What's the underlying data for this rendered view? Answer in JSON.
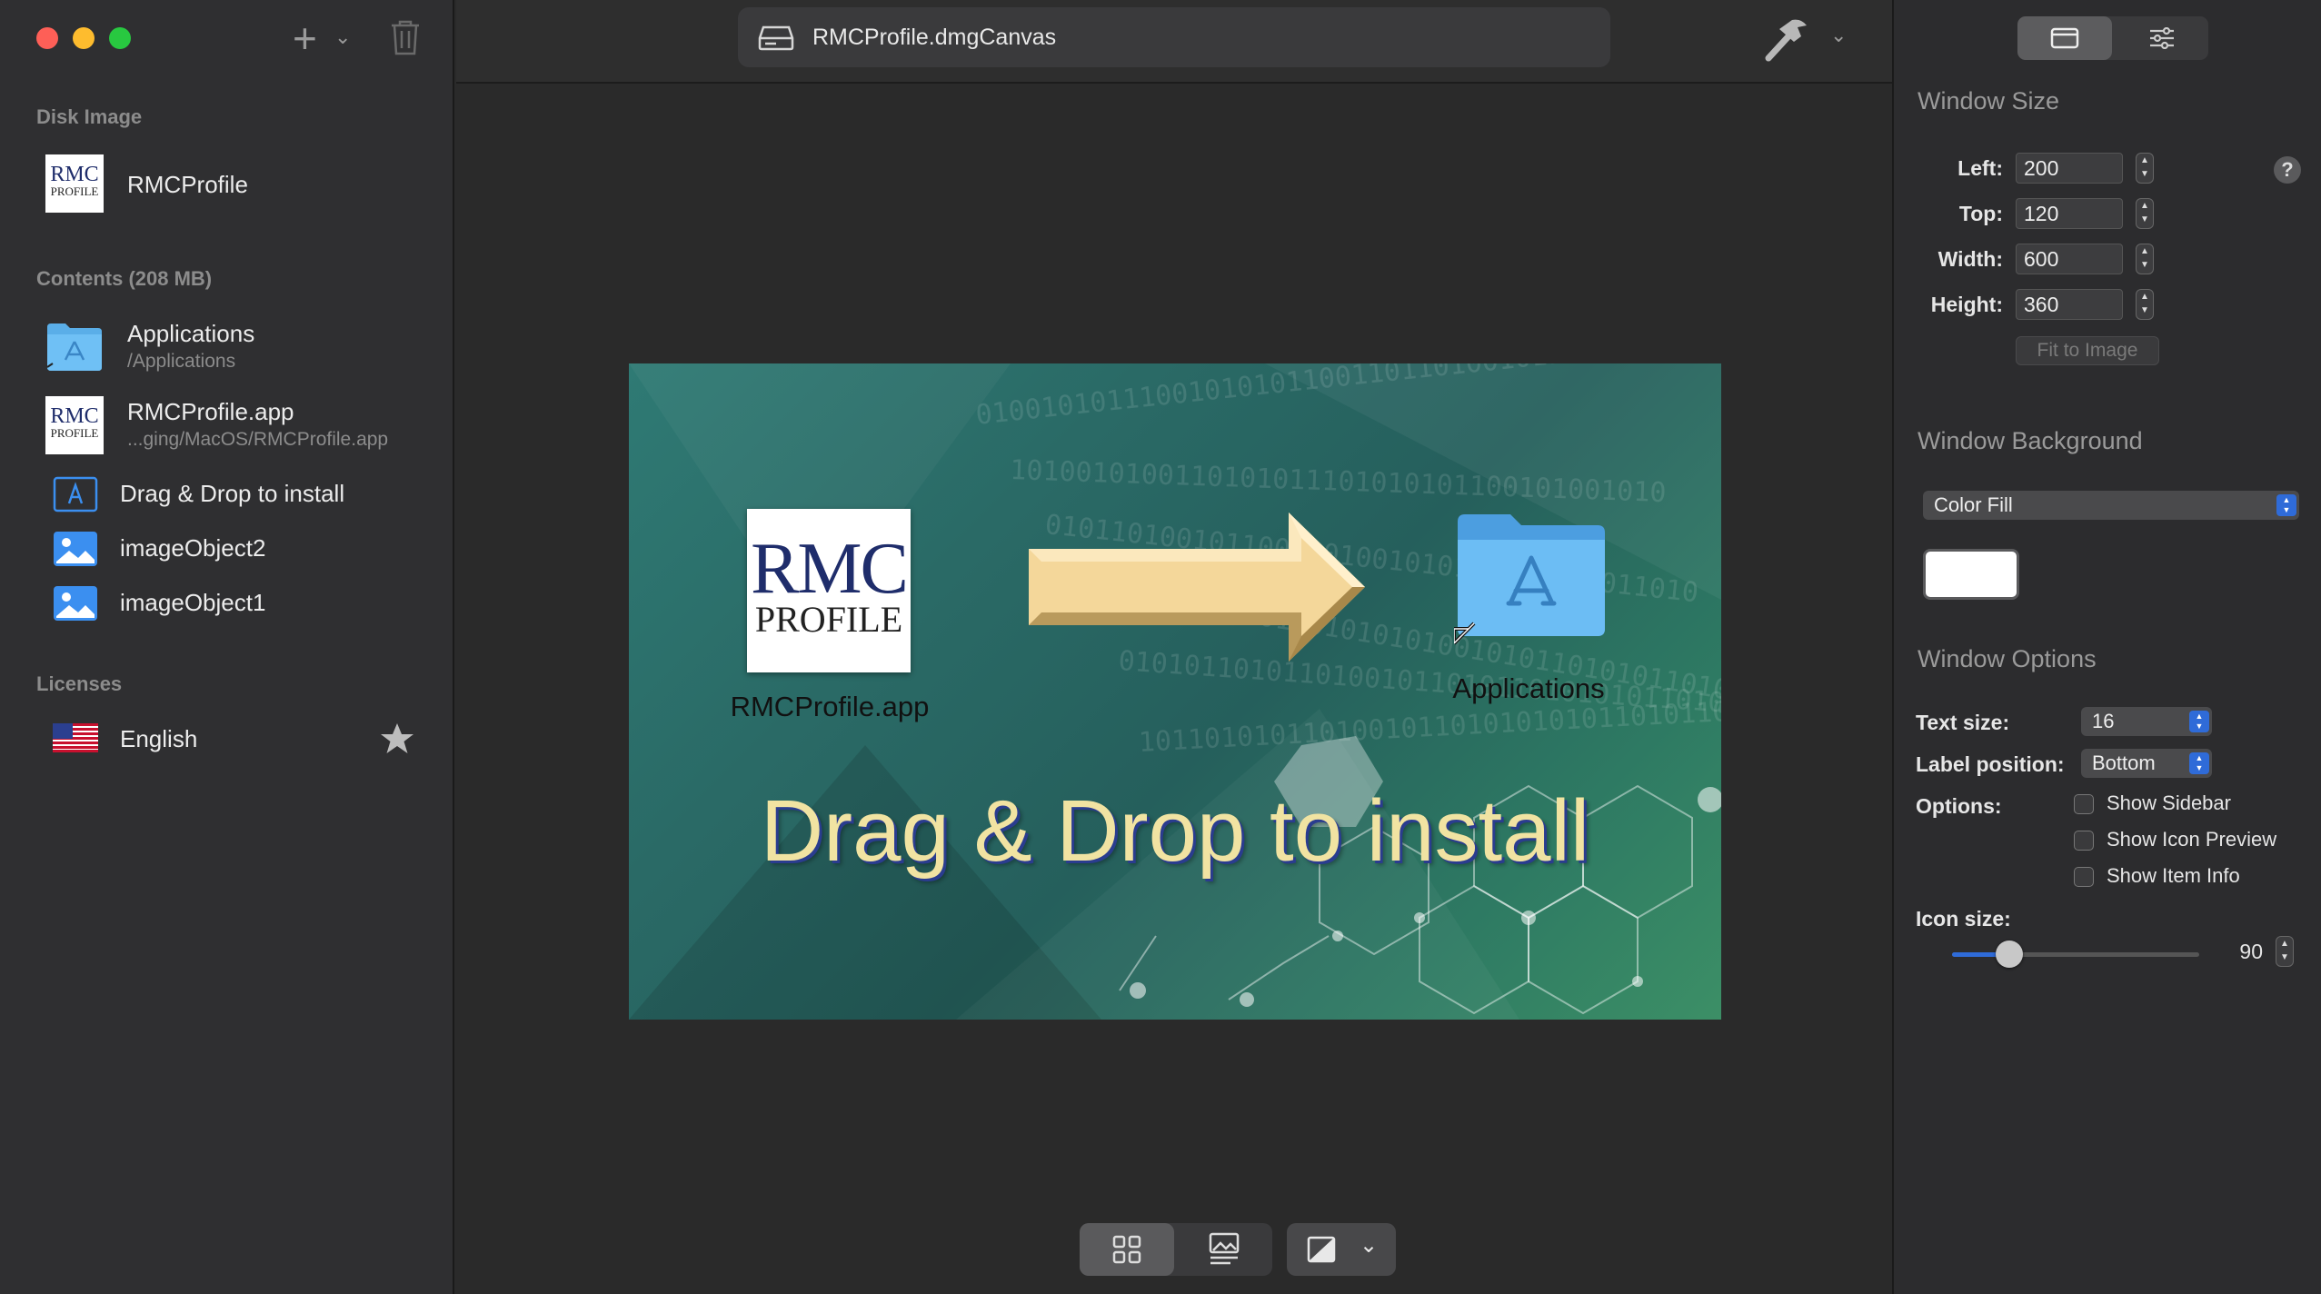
{
  "colors": {
    "accent": "#2f6bd8",
    "sidebar_bg": "#2f2f31",
    "canvas_text": "#f1e3a2"
  },
  "sidebar": {
    "section_disk": "Disk Image",
    "disk_item": {
      "label": "RMCProfile",
      "thumb_line1": "RMC",
      "thumb_line2": "PROFILE"
    },
    "section_contents": "Contents (208 MB)",
    "contents": [
      {
        "label": "Applications",
        "subtitle": "/Applications",
        "icon": "applications-folder-icon"
      },
      {
        "label": "RMCProfile.app",
        "subtitle": "...ging/MacOS/RMCProfile.app",
        "icon": "rmc-app-icon"
      },
      {
        "label": "Drag & Drop to install",
        "icon": "text-object-icon"
      },
      {
        "label": "imageObject2",
        "icon": "image-object-icon"
      },
      {
        "label": "imageObject1",
        "icon": "image-object-icon"
      }
    ],
    "section_licenses": "Licenses",
    "license_item": {
      "label": "English",
      "icon": "us-flag-icon"
    }
  },
  "toolbar": {
    "title": "RMCProfile.dmgCanvas"
  },
  "canvas": {
    "app_icon_line1": "RMC",
    "app_icon_line2": "PROFILE",
    "app_label": "RMCProfile.app",
    "folder_label": "Applications",
    "background_text": "Drag & Drop to install",
    "binary_rows": [
      "01001010111001010101100110110100101101",
      "1010010100110101011101010101100101001010",
      "0101101001011000101001010110101101011010",
      "10101110101011010101010010101101010110101",
      "0101011010110100101101011010101011010010",
      "1011010101101001011010101010110101101010"
    ]
  },
  "inspector": {
    "window_size_title": "Window Size",
    "fields": [
      {
        "label": "Left:",
        "value": "200"
      },
      {
        "label": "Top:",
        "value": "120"
      },
      {
        "label": "Width:",
        "value": "600"
      },
      {
        "label": "Height:",
        "value": "360"
      }
    ],
    "help": "?",
    "fit_button": "Fit to Image",
    "window_background_title": "Window Background",
    "background_select": "Color Fill",
    "window_options_title": "Window Options",
    "text_size_label": "Text size:",
    "text_size_value": "16",
    "label_position_label": "Label position:",
    "label_position_value": "Bottom",
    "options_label": "Options:",
    "options": [
      {
        "label": "Show Sidebar",
        "checked": false
      },
      {
        "label": "Show Icon Preview",
        "checked": false
      },
      {
        "label": "Show Item Info",
        "checked": false
      }
    ],
    "icon_size_label": "Icon size:",
    "icon_size_value": "90",
    "icon_size_fraction": 0.2
  }
}
